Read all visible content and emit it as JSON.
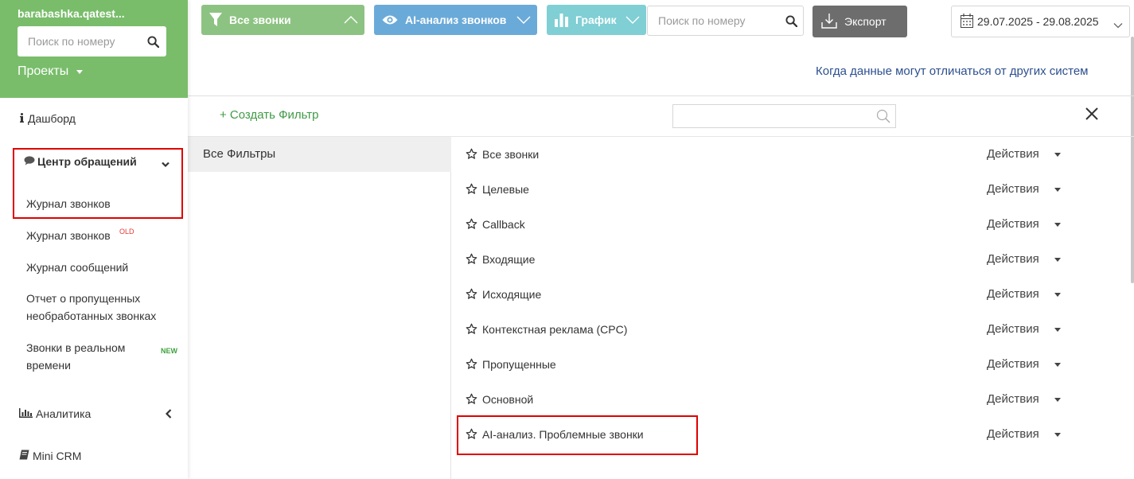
{
  "sidebar": {
    "account": "barabashka.qatest...",
    "search_placeholder": "Поиск по номеру",
    "projects_label": "Проекты",
    "dashboard": "Дашборд",
    "group_title": "Центр обращений",
    "items": [
      {
        "label": "Журнал звонков"
      },
      {
        "label": "Журнал звонков",
        "badge": "OLD"
      },
      {
        "label": "Журнал сообщений"
      },
      {
        "label": "Отчет о пропущенных необработанных звонках"
      },
      {
        "label": "Звонки в реальном времени",
        "badge": "NEW"
      }
    ],
    "analytics": "Аналитика",
    "mini_crm": "Mini CRM"
  },
  "toolbar": {
    "all_calls": "Все звонки",
    "ai_analysis": "AI-анализ звонков",
    "graph": "График",
    "search_placeholder": "Поиск по номеру",
    "export": "Экспорт",
    "date_range": "29.07.2025 - 29.08.2025",
    "note_link": "Когда данные могут отличаться от других систем"
  },
  "filters_panel": {
    "create_filter": "+ Создать Фильтр",
    "all_filters": "Все Фильтры",
    "actions_label": "Действия",
    "items": [
      {
        "label": "Все звонки"
      },
      {
        "label": "Целевые"
      },
      {
        "label": "Callback"
      },
      {
        "label": "Входящие"
      },
      {
        "label": "Исходящие"
      },
      {
        "label": "Контекстная реклама (CPC)"
      },
      {
        "label": "Пропущенные"
      },
      {
        "label": "Основной"
      },
      {
        "label": "AI-анализ. Проблемные звонки"
      }
    ]
  },
  "colors": {
    "sidebar_header": "#79bd6b",
    "btn_calls": "#8dc382",
    "btn_ai": "#6aaad9",
    "btn_graph": "#7fcfd4",
    "btn_export": "#6d6d6d",
    "highlight": "#e00000",
    "link": "#2c4f8f",
    "create_link": "#3f9b46"
  }
}
